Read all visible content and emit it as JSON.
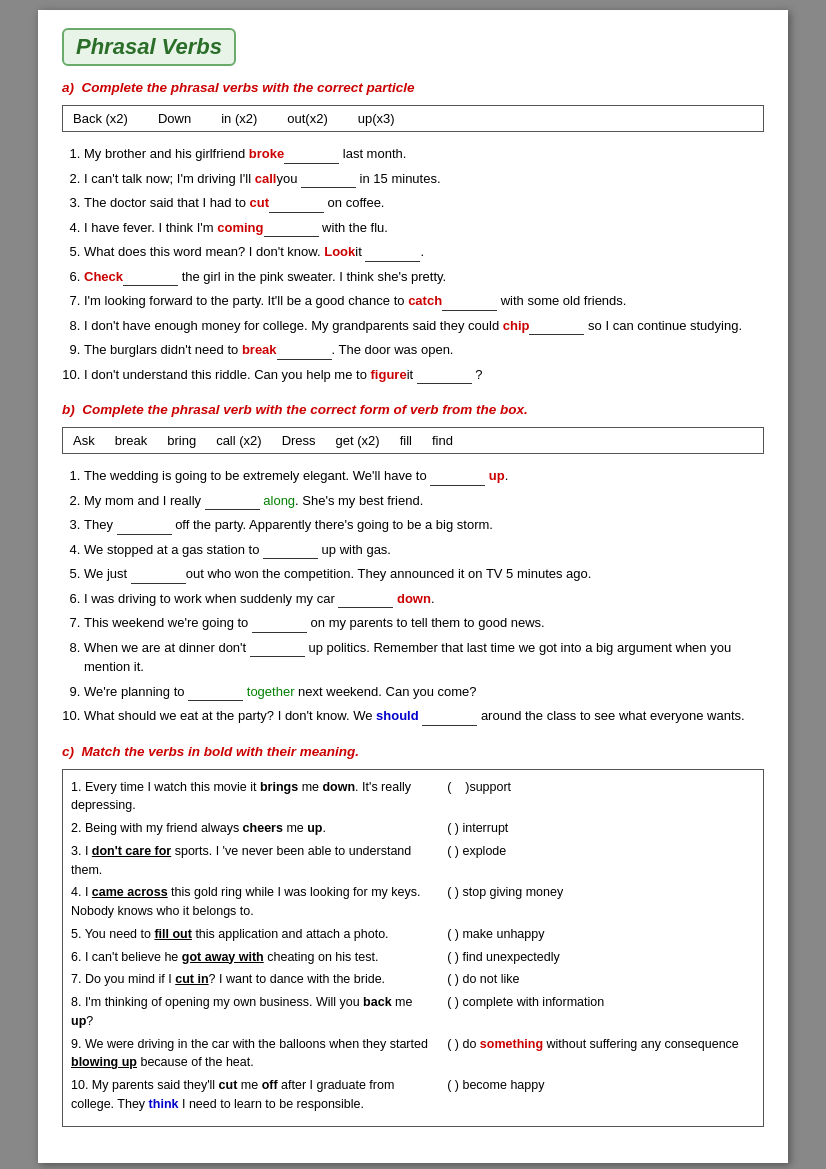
{
  "title": "Phrasal Verbs",
  "section_a": {
    "label": "a)",
    "title": "Complete the phrasal verbs with the correct particle",
    "word_bank": [
      "Back (x2)",
      "Down",
      "in (x2)",
      "out(x2)",
      "up(x3)"
    ],
    "items": [
      "My brother and his girlfriend **broke**_______ last month.",
      "I can't talk now; I'm driving I'll **call**you _______ in 15 minutes.",
      "The doctor said that I had to **cut**_______ on coffee.",
      "I have fever. I think I'm **coming**_______ with the flu.",
      "What does this word mean? I don't know. **Look**it _______.",
      "**Check**_______ the girl in the pink sweater. I think she's pretty.",
      "I'm looking forward to the party. It'll be a good chance to **catch**_____ with some old friends.",
      "I don't have enough money for college. My grandparents said they could **chip**_______ so I can continue studying.",
      "The burglars didn't need to **break**_______. The door was open.",
      "I don't understand this riddle. Can you help me to **figure**it _______ ?"
    ]
  },
  "section_b": {
    "label": "b)",
    "title": "Complete the phrasal verb with the correct form of verb from the box.",
    "word_bank": [
      "Ask",
      "break",
      "bring",
      "call (x2)",
      "Dress",
      "get (x2)",
      "fill",
      "find"
    ],
    "items": [
      {
        "text": "The wedding is going to be extremely elegant. We'll have to _________ up.",
        "color_word": "up",
        "color": "red"
      },
      {
        "text": "My mom and I really _________ along. She's my best friend.",
        "color_word": "along",
        "color": "green"
      },
      {
        "text": "They _________ off the party. Apparently there's going to be a big storm.",
        "color_word": "off",
        "color": "none"
      },
      {
        "text": "We stopped at a gas station to ________ up with gas.",
        "color_word": "up",
        "color": "none"
      },
      {
        "text": "We just _________out who won the competition. They announced it on TV 5 minutes ago.",
        "color_word": "out",
        "color": "none"
      },
      {
        "text": "I was driving to work when suddenly my car _________ down.",
        "color_word": "down",
        "color": "red"
      },
      {
        "text": "This weekend we're going to _________ on my parents to tell them to good news.",
        "color_word": "on",
        "color": "none"
      },
      {
        "text": "When we are at dinner don't _________ up politics. Remember that last time we got into a big argument when you mention it.",
        "color_word": "up",
        "color": "none"
      },
      {
        "text": "We're planning to ________ together next weekend. Can you come?",
        "color_word": "together",
        "color": "green"
      },
      {
        "text": "What should we eat at the party? I don't know. We should _________ around the class to see what everyone wants.",
        "color_word": "around",
        "color": "none"
      }
    ]
  },
  "section_c": {
    "label": "c)",
    "title": "Match the verbs in bold with their meaning.",
    "items": [
      {
        "left": "1. Every time I watch this movie it **brings** me **down**. It's really depressing.",
        "right": "( )support"
      },
      {
        "left": "2. Being with my friend always **cheers** me **up**.",
        "right": "( ) interrupt"
      },
      {
        "left": "3. I **don't care for** sports. I 've never been able to understand them.",
        "right": "( ) explode"
      },
      {
        "left": "4. I **came across** this gold ring while I was looking for my keys. Nobody knows who it belongs to.",
        "right": "( ) stop giving money"
      },
      {
        "left": "5. You need to **fill out** this application and attach a photo.",
        "right": "( ) make unhappy"
      },
      {
        "left": "6. I can't believe he **got away with** cheating on his test.",
        "right": "( ) find unexpectedly"
      },
      {
        "left": "7. Do you mind if I **cut in**? I want to dance with the bride.",
        "right": "( ) do not like"
      },
      {
        "left": "8. I'm thinking of opening my own business. Will you **back** me **up**?",
        "right": "( ) complete with information"
      },
      {
        "left": "9. We were driving in the car with the balloons when they started **blowing up** because of the heat.",
        "right": "( ) do something without suffering any consequence"
      },
      {
        "left": "10. My parents said they'll **cut** me **off** after I graduate from college. They think I need to learn to be responsible.",
        "right": "( ) become happy"
      }
    ]
  }
}
